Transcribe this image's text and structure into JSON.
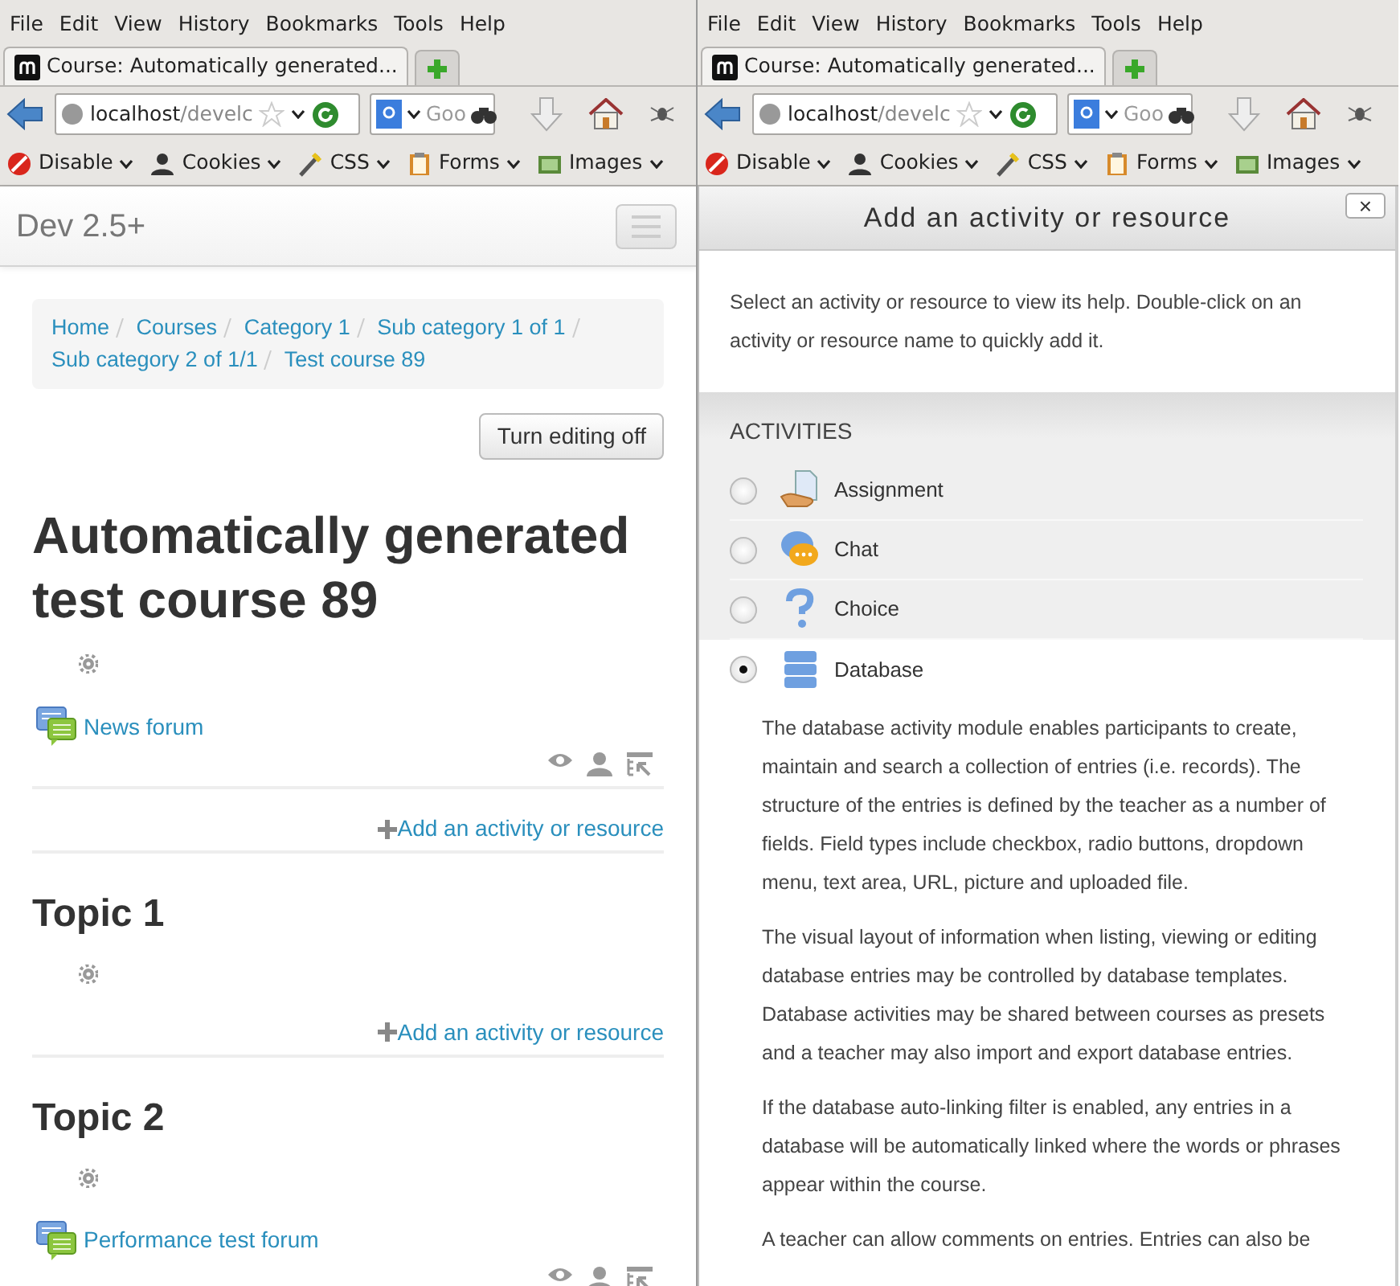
{
  "browsers": [
    {
      "menu": [
        "File",
        "Edit",
        "View",
        "History",
        "Bookmarks",
        "Tools",
        "Help"
      ],
      "tab": {
        "title": "Course: Automatically generated..."
      },
      "address": {
        "host": "localhost",
        "path": "/develc"
      },
      "search": {
        "placeholder": "Goo"
      },
      "dev_toolbar": [
        {
          "kind": "disable",
          "label": "Disable"
        },
        {
          "kind": "cookies",
          "label": "Cookies"
        },
        {
          "kind": "css",
          "label": "CSS"
        },
        {
          "kind": "forms",
          "label": "Forms"
        },
        {
          "kind": "images",
          "label": "Images"
        }
      ]
    },
    {
      "menu": [
        "File",
        "Edit",
        "View",
        "History",
        "Bookmarks",
        "Tools",
        "Help"
      ],
      "tab": {
        "title": "Course: Automatically generated..."
      },
      "address": {
        "host": "localhost",
        "path": "/develc"
      },
      "search": {
        "placeholder": "Goo"
      },
      "dev_toolbar": [
        {
          "kind": "disable",
          "label": "Disable"
        },
        {
          "kind": "cookies",
          "label": "Cookies"
        },
        {
          "kind": "css",
          "label": "CSS"
        },
        {
          "kind": "forms",
          "label": "Forms"
        },
        {
          "kind": "images",
          "label": "Images"
        }
      ]
    }
  ],
  "course_page": {
    "site_name": "Dev 2.5+",
    "breadcrumb": [
      "Home",
      "Courses",
      "Category 1",
      "Sub category 1 of 1",
      "Sub category 2 of 1/1",
      "Test course 89"
    ],
    "editing_button": "Turn editing off",
    "title": "Automatically generated test course 89",
    "sections": [
      {
        "activities": [
          {
            "name": "News forum"
          }
        ],
        "add_link": "Add an activity or resource"
      },
      {
        "title": "Topic 1",
        "add_link": "Add an activity or resource"
      },
      {
        "title": "Topic 2",
        "activities": [
          {
            "name": "Performance test forum"
          }
        ]
      }
    ]
  },
  "chooser": {
    "title": "Add an activity or resource",
    "close": "×",
    "intro": "Select an activity or resource to view its help. Double-click on an activity or resource name to quickly add it.",
    "category": "ACTIVITIES",
    "options": [
      {
        "kind": "assignment",
        "label": "Assignment",
        "selected": false
      },
      {
        "kind": "chat",
        "label": "Chat",
        "selected": false
      },
      {
        "kind": "choice",
        "label": "Choice",
        "selected": false
      },
      {
        "kind": "database",
        "label": "Database",
        "selected": true
      }
    ],
    "description": [
      "The database activity module enables participants to create, maintain and search a collection of entries (i.e. records). The structure of the entries is defined by the teacher as a number of fields. Field types include checkbox, radio buttons, dropdown menu, text area, URL, picture and uploaded file.",
      "The visual layout of information when listing, viewing or editing database entries may be controlled by database templates. Database activities may be shared between courses as presets and a teacher may also import and export database entries.",
      "If the database auto-linking filter is enabled, any entries in a database will be automatically linked where the words or phrases appear within the course.",
      "A teacher can allow comments on entries. Entries can also be"
    ]
  }
}
